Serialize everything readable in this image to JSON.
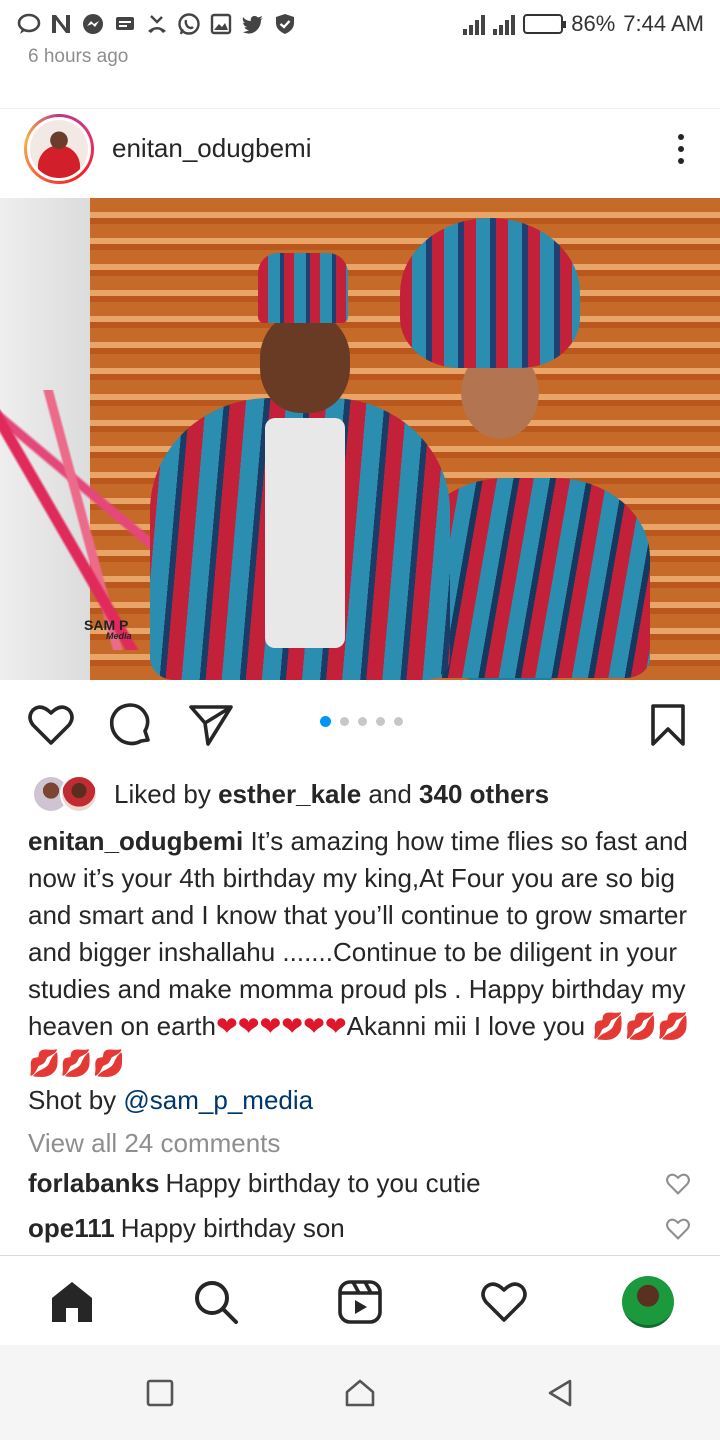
{
  "status_bar": {
    "battery": "86%",
    "battery_level": 0.86,
    "time": "7:44 AM",
    "notification_icons": [
      "chat-bubble-icon",
      "n-icon",
      "messenger-icon",
      "sms-icon",
      "missed-call-icon",
      "whatsapp-icon",
      "gallery-icon",
      "twitter-icon",
      "shield-icon"
    ]
  },
  "post": {
    "time_ago": "6 hours ago",
    "username": "enitan_odugbemi",
    "photo_watermark": {
      "line1": "SAM P",
      "line2": "Media"
    },
    "carousel": {
      "count": 5,
      "active_index": 0
    },
    "likes": {
      "prefix": "Liked by",
      "user": "esther_kale",
      "middle": "and",
      "others": "340 others"
    },
    "caption": {
      "user": "enitan_odugbemi",
      "text": "It’s amazing how time flies so fast and now it’s your 4th birthday my king,At Four you are so big and smart and I know that you’ll continue to grow smarter and bigger inshallahu .......Continue to be diligent in your studies and make momma proud pls .  Happy birthday my heaven on earth",
      "hearts_1": "❤❤❤❤❤❤",
      "text_2": "Akanni mii I love you ",
      "lips": "💋💋💋💋💋💋",
      "shot_by": "Shot by ",
      "mention": "@sam_p_media"
    },
    "view_comments": "View all 24 comments",
    "comments": [
      {
        "user": "forlabanks",
        "text": "Happy birthday to you cutie"
      },
      {
        "user": "ope111",
        "text": "Happy birthday son"
      }
    ]
  },
  "colors": {
    "accent": "#0095f6",
    "mention": "#00376b",
    "muted": "#8e8e8e",
    "heart": "#e0162b"
  }
}
